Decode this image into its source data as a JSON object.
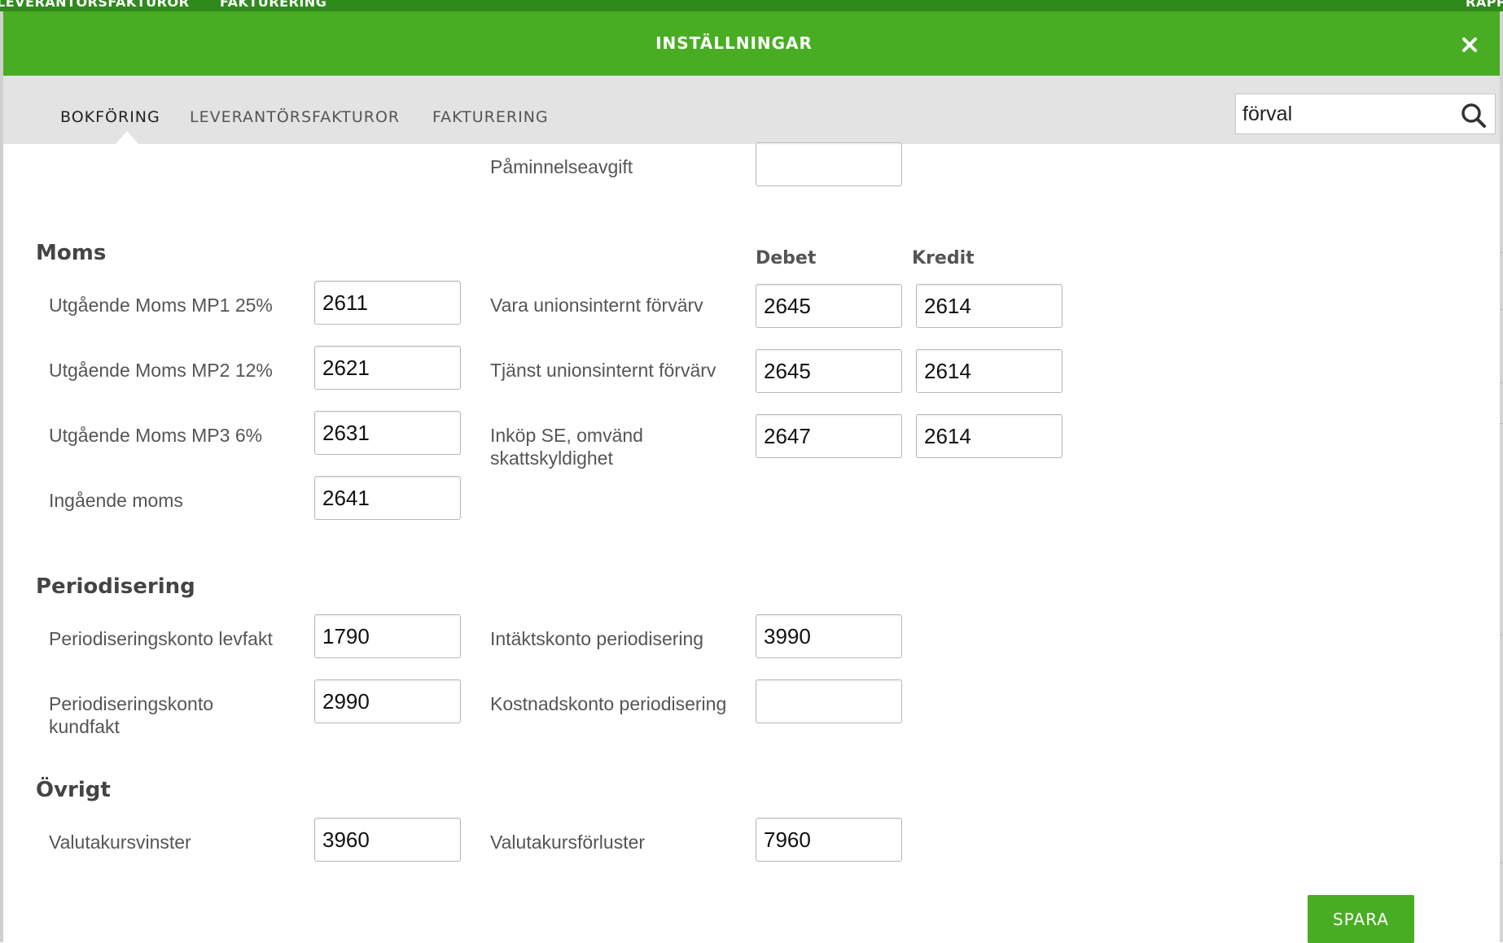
{
  "background": {
    "nav_items": [
      "LEVERANTÖRSFAKTUROR",
      "FAKTURERING",
      "RAPP"
    ]
  },
  "modal": {
    "title": "INSTÄLLNINGAR",
    "close_icon": "close-icon",
    "tabs": [
      {
        "label": "BOKFÖRING",
        "active": true
      },
      {
        "label": "LEVERANTÖRSFAKTUROR",
        "active": false
      },
      {
        "label": "FAKTURERING",
        "active": false
      }
    ],
    "search": {
      "value": "förval",
      "icon": "search-icon"
    }
  },
  "reminder": {
    "label": "Påminnelseavgift",
    "value": ""
  },
  "moms": {
    "title": "Moms",
    "debet_header": "Debet",
    "kredit_header": "Kredit",
    "left_fields": [
      {
        "label": "Utgående Moms MP1 25%",
        "value": "2611"
      },
      {
        "label": "Utgående Moms MP2 12%",
        "value": "2621"
      },
      {
        "label": "Utgående Moms MP3 6%",
        "value": "2631"
      },
      {
        "label": "Ingående moms",
        "value": "2641"
      }
    ],
    "right_fields": [
      {
        "label": "Vara unionsinternt förvärv",
        "debet": "2645",
        "kredit": "2614"
      },
      {
        "label": "Tjänst unionsinternt förvärv",
        "debet": "2645",
        "kredit": "2614"
      },
      {
        "label": "Inköp SE, omvänd skattskyldighet",
        "debet": "2647",
        "kredit": "2614"
      }
    ]
  },
  "periodisering": {
    "title": "Periodisering",
    "fields": [
      {
        "label": "Periodiseringskonto levfakt",
        "value": "1790"
      },
      {
        "label": "Periodiseringskonto kundfakt",
        "value": "2990"
      },
      {
        "label": "Intäktskonto periodisering",
        "value": "3990"
      },
      {
        "label": "Kostnadskonto periodisering",
        "value": ""
      }
    ]
  },
  "ovrigt": {
    "title": "Övrigt",
    "fields": [
      {
        "label": "Valutakursvinster",
        "value": "3960"
      },
      {
        "label": "Valutakursförluster",
        "value": "7960"
      }
    ]
  },
  "actions": {
    "save_label": "SPARA"
  },
  "colors": {
    "accent": "#48ad22",
    "tabbar": "#e3e3e3",
    "dark_green": "#2f8a1c"
  }
}
